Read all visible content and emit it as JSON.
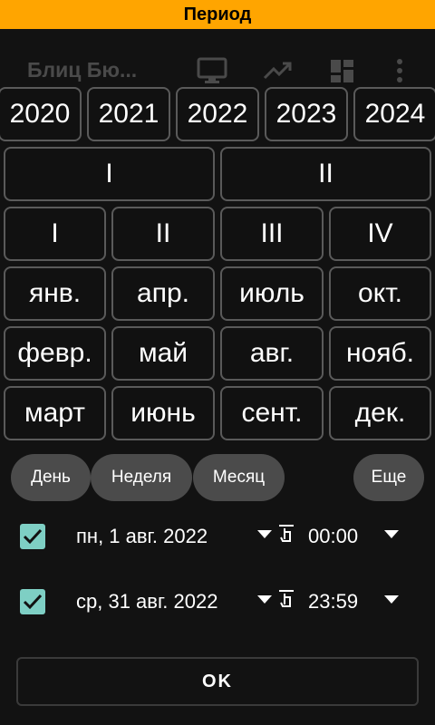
{
  "title": "Период",
  "app": {
    "title": "Блиц Бю..."
  },
  "years": [
    "2020",
    "2021",
    "2022",
    "2023",
    "2024"
  ],
  "halves": [
    "I",
    "II"
  ],
  "quarters": [
    "I",
    "II",
    "III",
    "IV"
  ],
  "months": [
    [
      "янв.",
      "апр.",
      "июль",
      "окт."
    ],
    [
      "февр.",
      "май",
      "авг.",
      "нояб."
    ],
    [
      "март",
      "июнь",
      "сент.",
      "дек."
    ]
  ],
  "chips": {
    "day": "День",
    "week": "Неделя",
    "month": "Месяц",
    "more": "Еще"
  },
  "start": {
    "checked": true,
    "date": "пн, 1 авг. 2022",
    "time": "00:00"
  },
  "end": {
    "checked": true,
    "date": "ср, 31 авг. 2022",
    "time": "23:59"
  },
  "ok_label": "OK",
  "colors": {
    "titlebar": "#FFA500",
    "checkbox": "#7ecfc4",
    "chip": "#4b4b4b"
  }
}
